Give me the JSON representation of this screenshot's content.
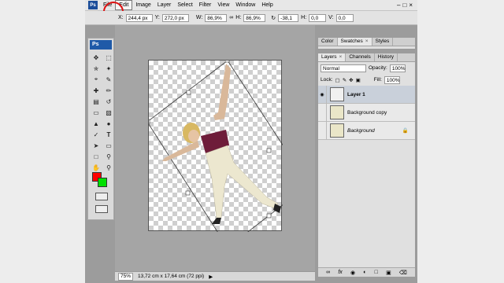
{
  "menubar": {
    "logo": "Ps",
    "items": [
      "File",
      "Edit",
      "Image",
      "Layer",
      "Select",
      "Filter",
      "View",
      "Window",
      "Help"
    ],
    "active_index": 1
  },
  "options": {
    "x_label": "X:",
    "x_value": "244,4 px",
    "y_label": "Y:",
    "y_value": "272,0 px",
    "w_label": "W:",
    "w_value": "86,9%",
    "h_label": "H:",
    "h_value": "86,9%",
    "angle_value": "-38,1",
    "hskew_label": "H:",
    "hskew_value": "0,0",
    "vskew_label": "V:",
    "vskew_value": "0,0"
  },
  "toolbox": {
    "logo": "Ps",
    "tools": [
      "move-icon",
      "marquee-icon",
      "lasso-icon",
      "magic-wand-icon",
      "crop-icon",
      "slice-icon",
      "healing-icon",
      "brush-icon",
      "stamp-icon",
      "history-brush-icon",
      "eraser-icon",
      "gradient-icon",
      "blur-icon",
      "dodge-icon",
      "pen-icon",
      "type-icon",
      "path-select-icon",
      "shape-icon",
      "notes-icon",
      "eyedropper-icon",
      "hand-icon",
      "zoom-icon"
    ],
    "foreground_color": "#ff0000",
    "background_color": "#00e000"
  },
  "statusbar": {
    "zoom": "75%",
    "doc_info": "13,72 cm x 17,64 cm (72 ppi)"
  },
  "swatches_panel": {
    "tabs": [
      "Color",
      "Swatches",
      "Styles"
    ],
    "active_tab": "Swatches"
  },
  "layers_panel": {
    "tabs": [
      "Layers",
      "Channels",
      "History"
    ],
    "active_tab": "Layers",
    "blend_mode": "Normal",
    "opacity_label": "Opacity:",
    "opacity_value": "100%",
    "lock_label": "Lock:",
    "fill_label": "Fill:",
    "fill_value": "100%",
    "layers": [
      {
        "name": "Layer 1",
        "selected": true,
        "visible": true
      },
      {
        "name": "Background copy",
        "selected": false,
        "visible": false
      },
      {
        "name": "Background",
        "selected": false,
        "visible": false,
        "locked": true
      }
    ],
    "footer_icons": [
      "link-icon",
      "fx-icon",
      "mask-icon",
      "adjustment-icon",
      "group-icon",
      "new-layer-icon",
      "trash-icon"
    ]
  }
}
